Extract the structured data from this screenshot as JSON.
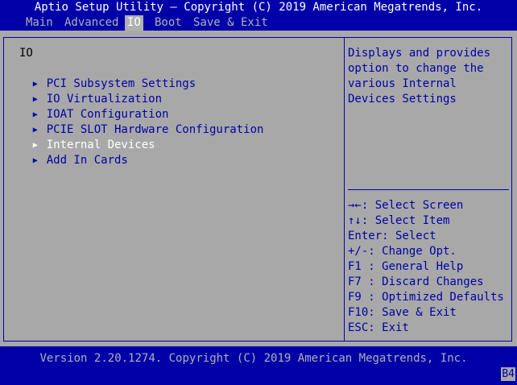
{
  "title": "Aptio Setup Utility – Copyright (C) 2019 American Megatrends, Inc.",
  "menu": [
    {
      "label": "Main",
      "active": false
    },
    {
      "label": "Advanced",
      "active": false
    },
    {
      "label": "IO",
      "active": true
    },
    {
      "label": "Boot",
      "active": false
    },
    {
      "label": "Save & Exit",
      "active": false
    }
  ],
  "page_heading": "IO",
  "items": [
    {
      "label": "PCI Subsystem Settings",
      "arrow": "▶"
    },
    {
      "label": "IO Virtualization",
      "arrow": "▶"
    },
    {
      "label": "IOAT Configuration",
      "arrow": "▶"
    },
    {
      "label": "PCIE SLOT Hardware Configuration",
      "arrow": "▶"
    },
    {
      "label": "Internal Devices",
      "arrow": "▶",
      "highlighted": true
    },
    {
      "label": "Add In Cards",
      "arrow": "▶"
    }
  ],
  "help_text": [
    "Displays and provides",
    "option to change the",
    "various Internal",
    "Devices Settings"
  ],
  "keys": [
    "→←: Select Screen",
    "↑↓: Select Item",
    "Enter: Select",
    "+/-: Change Opt.",
    "F1 : General Help",
    "F7 : Discard Changes",
    "F9 : Optimized Defaults",
    "F10: Save & Exit",
    "ESC: Exit"
  ],
  "footer": {
    "version": "Version 2.20.1274. Copyright (C) 2019 American Megatrends, Inc.",
    "code": "B4"
  },
  "colors": {
    "background_blue": "#0000a8",
    "panel_gray": "#a8a8a8",
    "inactive_text": "#b0b0b0",
    "highlight_text": "#ffffff"
  }
}
